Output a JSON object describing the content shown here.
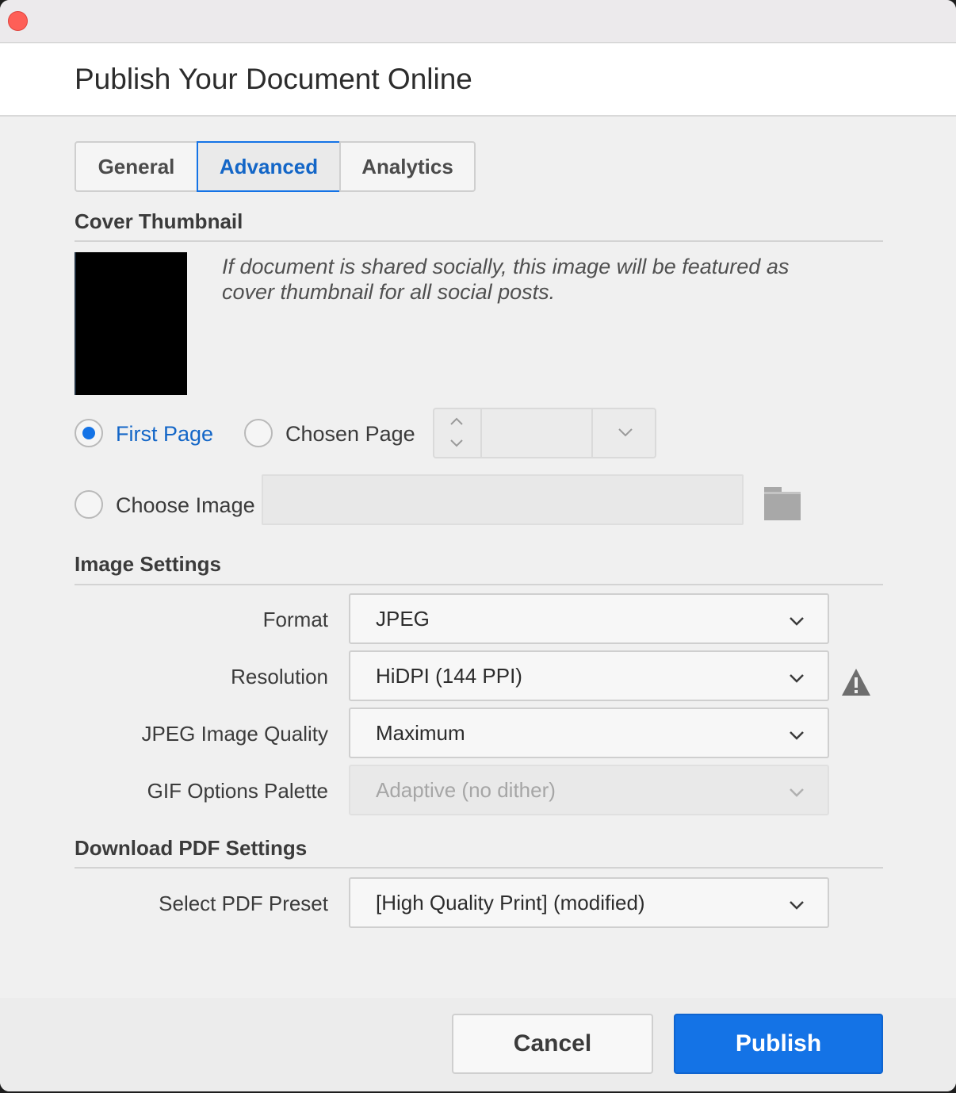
{
  "window": {
    "title": "Publish Your Document Online"
  },
  "tabs": [
    {
      "label": "General",
      "selected": false
    },
    {
      "label": "Advanced",
      "selected": true
    },
    {
      "label": "Analytics",
      "selected": false
    }
  ],
  "cover_thumbnail": {
    "title": "Cover Thumbnail",
    "description": "If document is shared socially, this image will be featured as cover thumbnail for all social posts.",
    "options": {
      "first_page": "First Page",
      "chosen_page": "Chosen Page",
      "choose_image": "Choose Image"
    },
    "selected_option": "First Page",
    "image_path": ""
  },
  "image_settings": {
    "title": "Image Settings",
    "format": {
      "label": "Format",
      "value": "JPEG"
    },
    "resolution": {
      "label": "Resolution",
      "value": "HiDPI (144 PPI)"
    },
    "jpeg_quality": {
      "label": "JPEG Image Quality",
      "value": "Maximum"
    },
    "gif_palette": {
      "label": "GIF Options Palette",
      "value": "Adaptive (no dither)",
      "disabled": true
    }
  },
  "download_pdf": {
    "title": "Download PDF Settings",
    "preset": {
      "label": "Select PDF Preset",
      "value": "[High Quality Print] (modified)"
    }
  },
  "footer": {
    "cancel_label": "Cancel",
    "publish_label": "Publish"
  },
  "colors": {
    "accent": "#1473e6",
    "close_button": "#fe5f57"
  },
  "icons": {
    "close": "close-icon",
    "folder": "folder-icon",
    "warning": "warning-icon",
    "chevron": "chevron-down-icon"
  }
}
